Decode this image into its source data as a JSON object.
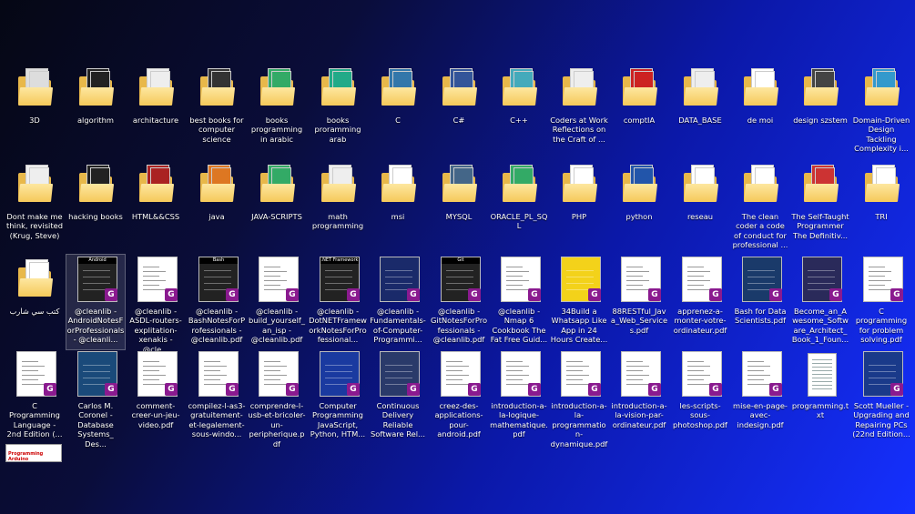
{
  "desktop": {
    "rows": [
      [
        {
          "label": "3D",
          "kind": "folder",
          "cover": "#ddd"
        },
        {
          "label": "algorithm",
          "kind": "folder",
          "cover": "#222"
        },
        {
          "label": "architacture",
          "kind": "folder",
          "cover": "#eee"
        },
        {
          "label": "best books for computer science",
          "kind": "folder",
          "cover": "#333"
        },
        {
          "label": "books programming in arabic",
          "kind": "folder",
          "cover": "#3a6"
        },
        {
          "label": "books proramming arab",
          "kind": "folder",
          "cover": "#2a8"
        },
        {
          "label": "C",
          "kind": "folder",
          "cover": "#37a"
        },
        {
          "label": "C#",
          "kind": "folder",
          "cover": "#359"
        },
        {
          "label": "C++",
          "kind": "folder",
          "cover": "#4ab"
        },
        {
          "label": "Coders at Work Reflections on the Craft of ...",
          "kind": "folder",
          "cover": "#eee"
        },
        {
          "label": "comptIA",
          "kind": "folder",
          "cover": "#c22"
        },
        {
          "label": "DATA_BASE",
          "kind": "folder",
          "cover": "#eee"
        },
        {
          "label": "de moi",
          "kind": "folder",
          "cover": "#fff"
        },
        {
          "label": "design szstem",
          "kind": "folder",
          "cover": "#444"
        },
        {
          "label": "Domain-Driven Design Tackling Complexity i...",
          "kind": "folder",
          "cover": "#39c"
        }
      ],
      [
        {
          "label": "Dont make me think, revisited (Krug, Steve)",
          "kind": "folder",
          "cover": "#eee"
        },
        {
          "label": "hacking books",
          "kind": "folder",
          "cover": "#222"
        },
        {
          "label": "HTML&&CSS",
          "kind": "folder",
          "cover": "#a22"
        },
        {
          "label": "java",
          "kind": "folder",
          "cover": "#d72"
        },
        {
          "label": "JAVA-SCRIPTS",
          "kind": "folder",
          "cover": "#3a6"
        },
        {
          "label": "math programming",
          "kind": "folder",
          "cover": "#eee"
        },
        {
          "label": "msi",
          "kind": "folder",
          "cover": "#fff"
        },
        {
          "label": "MYSQL",
          "kind": "folder",
          "cover": "#468"
        },
        {
          "label": "ORACLE_PL_SQL",
          "kind": "folder",
          "cover": "#3a6"
        },
        {
          "label": "PHP",
          "kind": "folder",
          "cover": "#fff"
        },
        {
          "label": "python",
          "kind": "folder",
          "cover": "#25a"
        },
        {
          "label": "reseau",
          "kind": "folder",
          "cover": "#fff"
        },
        {
          "label": "The clean coder a code of conduct for professional ...",
          "kind": "folder",
          "cover": "#fff"
        },
        {
          "label": "The Self-Taught Programmer The Definitiv...",
          "kind": "folder",
          "cover": "#c33"
        },
        {
          "label": "TRI",
          "kind": "folder",
          "cover": "#fff"
        }
      ],
      [
        {
          "label": "كتب سي شارب",
          "kind": "folder",
          "cover": "#fff"
        },
        {
          "label": "@cleanlib - AndroidNotesForProfessionals - @cleanli...",
          "kind": "pdf",
          "cover": "#222",
          "title": "Android"
        },
        {
          "label": "@cleanlib - ASDL-routers-explitation-xenakis - @cle...",
          "kind": "pdf",
          "cover": "#fff",
          "title": ""
        },
        {
          "label": "@cleanlib - BashNotesForProfessionals - @cleanlib.pdf",
          "kind": "pdf",
          "cover": "#222",
          "title": "Bash"
        },
        {
          "label": "@cleanlib - build_yourself_an_isp - @cleanlib.pdf",
          "kind": "pdf",
          "cover": "#fff",
          "title": ""
        },
        {
          "label": "@cleanlib - DotNETFrameworkNotesForProfessional...",
          "kind": "pdf",
          "cover": "#222",
          "title": ".NET Framework"
        },
        {
          "label": "@cleanlib - Fundamentals-of-Computer-Programmi...",
          "kind": "pdf",
          "cover": "#1a2a6a",
          "title": ""
        },
        {
          "label": "@cleanlib - GitNotesForProfessionals - @cleanlib.pdf",
          "kind": "pdf",
          "cover": "#222",
          "title": "Git"
        },
        {
          "label": "@cleanlib - Nmap 6 Cookbook The Fat Free Guid...",
          "kind": "pdf",
          "cover": "#fff",
          "title": ""
        },
        {
          "label": "34Build a Whatsapp Like App in 24 Hours Create...",
          "kind": "pdf",
          "cover": "#f3d21a",
          "title": ""
        },
        {
          "label": "88RESTful_Java_Web_Services.pdf",
          "kind": "pdf",
          "cover": "#fff",
          "title": ""
        },
        {
          "label": "apprenez-a-monter-votre-ordinateur.pdf",
          "kind": "pdf",
          "cover": "#fff",
          "title": ""
        },
        {
          "label": "Bash for Data Scientists.pdf",
          "kind": "pdf",
          "cover": "#1a3a6a",
          "title": ""
        },
        {
          "label": "Become_an_Awesome_Software_Architect_Book_1_Foun...",
          "kind": "pdf",
          "cover": "#2a2a5a",
          "title": ""
        },
        {
          "label": "C programming for problem solving.pdf",
          "kind": "pdf",
          "cover": "#fff",
          "title": ""
        }
      ],
      [
        {
          "label": "C Programming Language - 2nd Edition (...",
          "kind": "pdf",
          "cover": "#fff",
          "title": ""
        },
        {
          "label": "Carlos M. Coronel - Database Systems_ Des...",
          "kind": "pdf",
          "cover": "#1a4a7a",
          "title": ""
        },
        {
          "label": "comment-creer-un-jeu-video.pdf",
          "kind": "pdf",
          "cover": "#fff",
          "title": ""
        },
        {
          "label": "compilez-l-as3-gratuitement-et-legalement-sous-windo...",
          "kind": "pdf",
          "cover": "#fff",
          "title": ""
        },
        {
          "label": "comprendre-l-usb-et-bricoler-un-peripherique.pdf",
          "kind": "pdf",
          "cover": "#fff",
          "title": ""
        },
        {
          "label": "Computer Programming JavaScript, Python, HTM...",
          "kind": "pdf",
          "cover": "#1a3aa0",
          "title": ""
        },
        {
          "label": "Continuous Delivery Reliable Software Rel...",
          "kind": "pdf",
          "cover": "#2a3a6a",
          "title": ""
        },
        {
          "label": "creez-des-applications-pour-android.pdf",
          "kind": "pdf",
          "cover": "#fff",
          "title": ""
        },
        {
          "label": "introduction-a-la-logique-mathematique.pdf",
          "kind": "pdf",
          "cover": "#fff",
          "title": ""
        },
        {
          "label": "introduction-a-la-programmation-dynamique.pdf",
          "kind": "pdf",
          "cover": "#fff",
          "title": ""
        },
        {
          "label": "introduction-a-la-vision-par-ordinateur.pdf",
          "kind": "pdf",
          "cover": "#fff",
          "title": ""
        },
        {
          "label": "les-scripts-sous-photoshop.pdf",
          "kind": "pdf",
          "cover": "#fff",
          "title": ""
        },
        {
          "label": "mise-en-page-avec-indesign.pdf",
          "kind": "pdf",
          "cover": "#fff",
          "title": ""
        },
        {
          "label": "programming.txt",
          "kind": "txt",
          "cover": "#fff",
          "title": ""
        },
        {
          "label": "Scott Mueller - Upgrading and Repairing PCs (22nd Edition...",
          "kind": "pdf",
          "cover": "#1a3a8a",
          "title": ""
        }
      ]
    ],
    "stray_label": "Programming Arduino"
  }
}
